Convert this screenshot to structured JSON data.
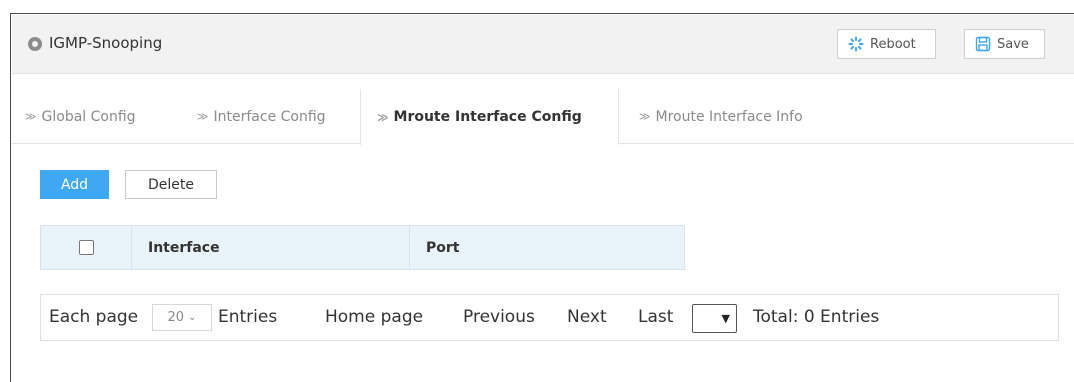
{
  "module": {
    "icon": "location-pin-icon",
    "title": "IGMP-Snooping"
  },
  "toolbar": {
    "reboot_label": "Reboot",
    "reboot_icon": "spinner-icon",
    "save_label": "Save",
    "save_icon": "floppy-disk-icon",
    "accent_color": "#3ea8f5"
  },
  "tabs": [
    {
      "label": "Global Config",
      "active": false
    },
    {
      "label": "Interface Config",
      "active": false
    },
    {
      "label": "Mroute Interface Config",
      "active": true
    },
    {
      "label": "Mroute Interface Info",
      "active": false
    }
  ],
  "actions": {
    "add_label": "Add",
    "delete_label": "Delete"
  },
  "table": {
    "columns": [
      "Interface",
      "Port"
    ],
    "rows": []
  },
  "pagination": {
    "each_page_label": "Each page",
    "page_size": "20",
    "entries_label": "Entries",
    "home_label": "Home page",
    "previous_label": "Previous",
    "next_label": "Next",
    "last_label": "Last",
    "page_select_value": "",
    "total_label": "Total: 0 Entries"
  }
}
